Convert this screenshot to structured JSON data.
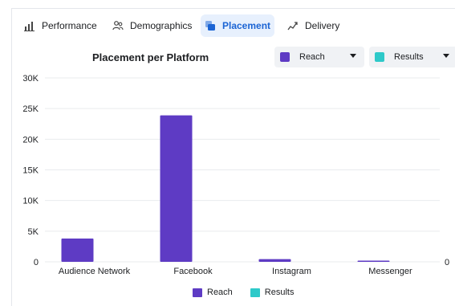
{
  "tabs": [
    {
      "label": "Performance",
      "icon": "bar-chart-icon"
    },
    {
      "label": "Demographics",
      "icon": "people-icon"
    },
    {
      "label": "Placement",
      "icon": "placement-icon",
      "active": true
    },
    {
      "label": "Delivery",
      "icon": "trend-icon"
    }
  ],
  "dropdowns": {
    "reach": {
      "label": "Reach",
      "color": "#5e3bc4"
    },
    "results": {
      "label": "Results",
      "color": "#2ec9c9"
    }
  },
  "colors": {
    "accent": "#1b64d4",
    "reach": "#5e3bc4",
    "results": "#2ec9c9"
  },
  "chart_data": {
    "type": "bar",
    "title": "Placement per Platform",
    "categories": [
      "Audience Network",
      "Facebook",
      "Instagram",
      "Messenger"
    ],
    "series": [
      {
        "name": "Reach",
        "values": [
          3800,
          23900,
          450,
          40
        ]
      },
      {
        "name": "Results",
        "values": [
          0,
          0,
          0,
          0
        ]
      }
    ],
    "y_ticks": [
      "0",
      "5K",
      "10K",
      "15K",
      "20K",
      "25K",
      "30K"
    ],
    "y2_ticks": [
      "0"
    ],
    "ylim": [
      0,
      30000
    ],
    "grid": true,
    "legend_position": "bottom"
  }
}
